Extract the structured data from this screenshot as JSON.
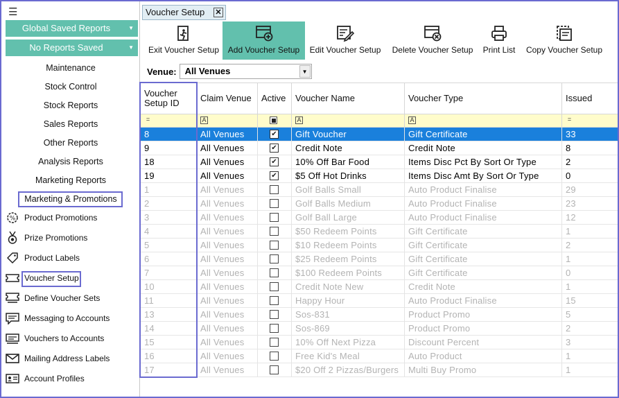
{
  "sidebar": {
    "global_saved_reports": "Global Saved Reports",
    "no_reports_saved": "No Reports Saved",
    "menu": [
      "Maintenance",
      "Stock Control",
      "Stock Reports",
      "Sales Reports",
      "Other Reports",
      "Analysis Reports",
      "Marketing Reports",
      "Marketing & Promotions"
    ],
    "items": [
      {
        "label": "Product Promotions",
        "icon": "gear-percent-icon"
      },
      {
        "label": "Prize Promotions",
        "icon": "medal-icon"
      },
      {
        "label": "Product Labels",
        "icon": "tag-icon"
      },
      {
        "label": "Voucher Setup",
        "icon": "ticket-icon"
      },
      {
        "label": "Define Voucher Sets",
        "icon": "ticket-stack-icon"
      },
      {
        "label": "Messaging to Accounts",
        "icon": "message-icon"
      },
      {
        "label": "Vouchers to Accounts",
        "icon": "voucher-send-icon"
      },
      {
        "label": "Mailing Address Labels",
        "icon": "envelope-icon"
      },
      {
        "label": "Account Profiles",
        "icon": "id-card-icon"
      }
    ]
  },
  "tab": {
    "label": "Voucher Setup",
    "close": "✕"
  },
  "toolbar": {
    "exit": "Exit Voucher Setup",
    "add": "Add Voucher Setup",
    "edit": "Edit Voucher Setup",
    "delete": "Delete Voucher Setup",
    "print": "Print List",
    "copy": "Copy Voucher Setup"
  },
  "venue": {
    "label": "Venue:",
    "value": "All Venues"
  },
  "grid": {
    "columns": [
      "Voucher Setup ID",
      "Claim Venue",
      "Active",
      "Voucher Name",
      "Voucher Type",
      "Issued"
    ],
    "rows": [
      {
        "id": "8",
        "venue": "All Venues",
        "active": true,
        "name": "Gift Voucher",
        "type": "Gift Certificate",
        "issued": "33",
        "selected": true,
        "enabled": true
      },
      {
        "id": "9",
        "venue": "All Venues",
        "active": true,
        "name": "Credit Note",
        "type": "Credit Note",
        "issued": "8",
        "selected": false,
        "enabled": true
      },
      {
        "id": "18",
        "venue": "All Venues",
        "active": true,
        "name": "10% Off Bar Food",
        "type": "Items Disc Pct By Sort Or Type",
        "issued": "2",
        "selected": false,
        "enabled": true
      },
      {
        "id": "19",
        "venue": "All Venues",
        "active": true,
        "name": "$5 Off Hot Drinks",
        "type": "Items Disc Amt By Sort Or Type",
        "issued": "0",
        "selected": false,
        "enabled": true
      },
      {
        "id": "1",
        "venue": "All Venues",
        "active": false,
        "name": "Golf Balls Small",
        "type": "Auto Product Finalise",
        "issued": "29",
        "selected": false,
        "enabled": false
      },
      {
        "id": "2",
        "venue": "All Venues",
        "active": false,
        "name": "Golf Balls Medium",
        "type": "Auto Product Finalise",
        "issued": "23",
        "selected": false,
        "enabled": false
      },
      {
        "id": "3",
        "venue": "All Venues",
        "active": false,
        "name": "Golf Ball Large",
        "type": "Auto Product Finalise",
        "issued": "12",
        "selected": false,
        "enabled": false
      },
      {
        "id": "4",
        "venue": "All Venues",
        "active": false,
        "name": "$50 Redeem Points",
        "type": "Gift Certificate",
        "issued": "1",
        "selected": false,
        "enabled": false
      },
      {
        "id": "5",
        "venue": "All Venues",
        "active": false,
        "name": "$10 Redeem Points",
        "type": "Gift Certificate",
        "issued": "2",
        "selected": false,
        "enabled": false
      },
      {
        "id": "6",
        "venue": "All Venues",
        "active": false,
        "name": "$25 Redeem Points",
        "type": "Gift Certificate",
        "issued": "1",
        "selected": false,
        "enabled": false
      },
      {
        "id": "7",
        "venue": "All Venues",
        "active": false,
        "name": "$100 Redeem Points",
        "type": "Gift Certificate",
        "issued": "0",
        "selected": false,
        "enabled": false
      },
      {
        "id": "10",
        "venue": "All Venues",
        "active": false,
        "name": "Credit Note New",
        "type": "Credit Note",
        "issued": "1",
        "selected": false,
        "enabled": false
      },
      {
        "id": "11",
        "venue": "All Venues",
        "active": false,
        "name": "Happy Hour",
        "type": "Auto Product Finalise",
        "issued": "15",
        "selected": false,
        "enabled": false
      },
      {
        "id": "13",
        "venue": "All Venues",
        "active": false,
        "name": "Sos-831",
        "type": "Product Promo",
        "issued": "5",
        "selected": false,
        "enabled": false
      },
      {
        "id": "14",
        "venue": "All Venues",
        "active": false,
        "name": "Sos-869",
        "type": "Product Promo",
        "issued": "2",
        "selected": false,
        "enabled": false
      },
      {
        "id": "15",
        "venue": "All Venues",
        "active": false,
        "name": "10% Off Next Pizza",
        "type": "Discount Percent",
        "issued": "3",
        "selected": false,
        "enabled": false
      },
      {
        "id": "16",
        "venue": "All Venues",
        "active": false,
        "name": "Free Kid's Meal",
        "type": "Auto Product",
        "issued": "1",
        "selected": false,
        "enabled": false
      },
      {
        "id": "17",
        "venue": "All Venues",
        "active": false,
        "name": "$20 Off 2 Pizzas/Burgers",
        "type": "Multi Buy Promo",
        "issued": "1",
        "selected": false,
        "enabled": false
      }
    ]
  },
  "colors": {
    "accent": "#62c0ad",
    "selection": "#1a80dc",
    "highlight_box": "#6a6ad0",
    "filter_row": "#fffccb"
  }
}
